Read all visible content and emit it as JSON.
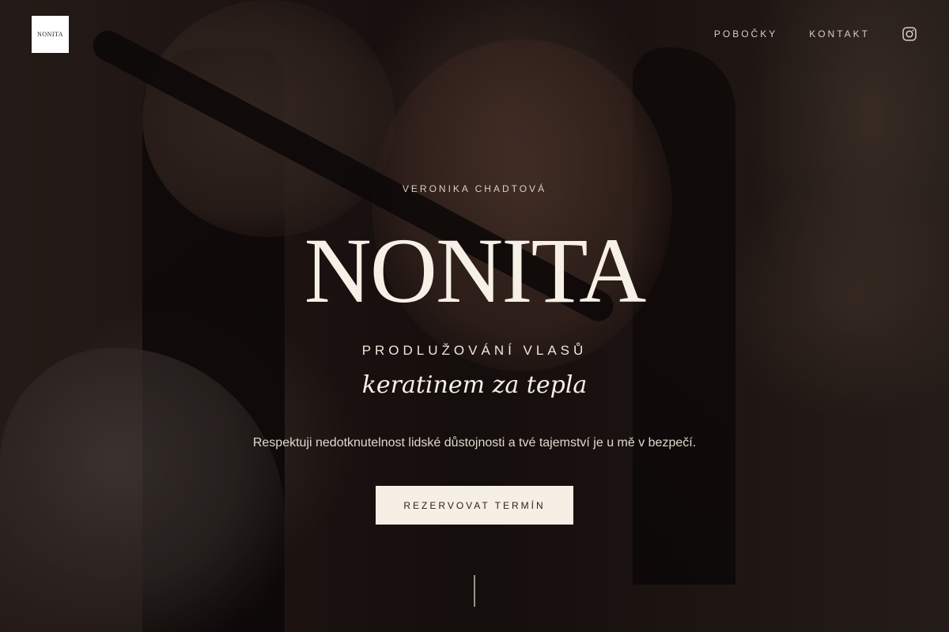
{
  "brand": {
    "logo_text": "NONITA"
  },
  "nav": {
    "items": [
      {
        "label": "POBOČKY"
      },
      {
        "label": "KONTAKT"
      }
    ],
    "instagram_icon": "instagram-icon"
  },
  "hero": {
    "subtitle": "VERONIKA CHADTOVÁ",
    "title": "NONITA",
    "service": "PRODLUŽOVÁNÍ VLASŮ",
    "script": "keratinem za tepla",
    "tagline": "Respektuji nedotknutelnost lidské důstojnosti a tvé tajemství je u mě v bezpečí.",
    "cta_label": "REZERVOVAT TERMÍN"
  },
  "colors": {
    "cta_background": "#f5efe6",
    "text": "#f3ece2",
    "overlay": "#0a0706"
  }
}
